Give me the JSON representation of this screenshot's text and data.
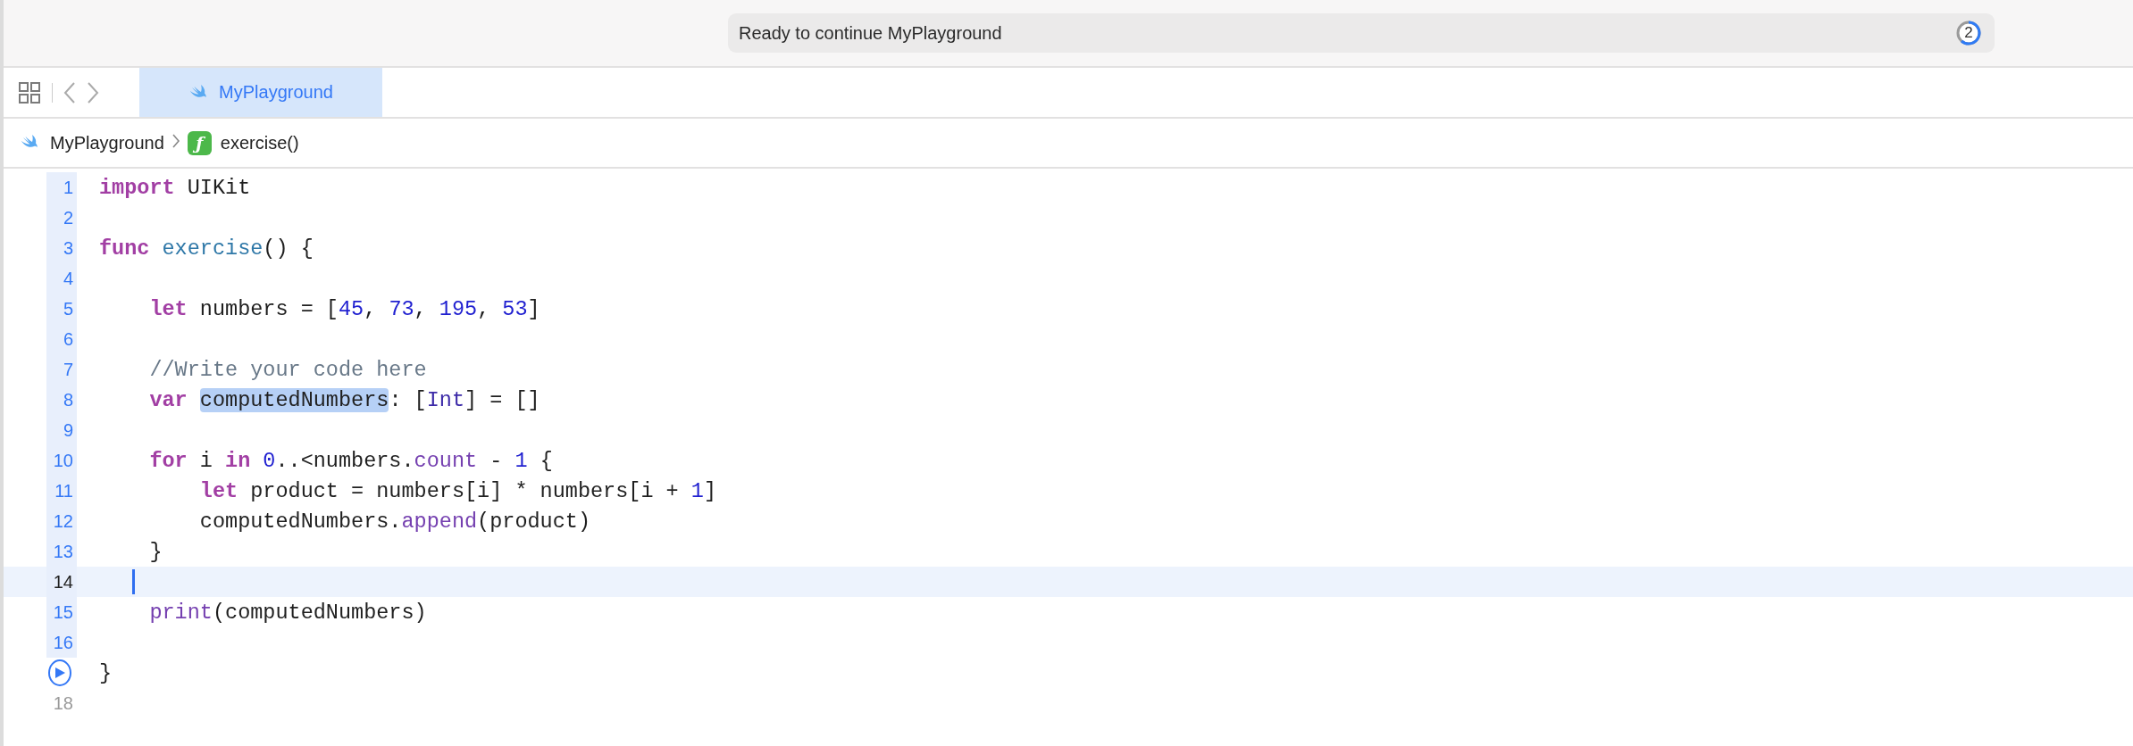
{
  "toolbar": {
    "status": "Ready to continue MyPlayground",
    "badge": "2"
  },
  "tabs": [
    {
      "label": "MyPlayground",
      "selected": true
    }
  ],
  "breadcrumb": [
    {
      "kind": "playground",
      "label": "MyPlayground"
    },
    {
      "kind": "function",
      "glyph": "ƒ",
      "label": "exercise()"
    }
  ],
  "editor": {
    "lines": [
      {
        "kind": "code",
        "number": "1",
        "ran": true,
        "current": false,
        "tokens": [
          {
            "kind": "keyword",
            "s": "import"
          },
          {
            "kind": "plain",
            "s": " UIKit"
          }
        ]
      },
      {
        "kind": "code",
        "number": "2",
        "ran": true,
        "current": false
      },
      {
        "kind": "code",
        "number": "3",
        "ran": true,
        "current": false,
        "tokens": [
          {
            "kind": "keyword",
            "s": "func "
          },
          {
            "kind": "decl",
            "s": "exercise"
          },
          {
            "kind": "plain",
            "s": "() {"
          }
        ]
      },
      {
        "kind": "code",
        "number": "4",
        "ran": true,
        "current": false
      },
      {
        "kind": "code",
        "number": "5",
        "ran": true,
        "current": false,
        "tokens": [
          {
            "kind": "keyword",
            "s": "    let"
          },
          {
            "kind": "plain",
            "s": " numbers = ["
          },
          {
            "kind": "number",
            "s": "45"
          },
          {
            "kind": "plain",
            "s": ", "
          },
          {
            "kind": "number",
            "s": "73"
          },
          {
            "kind": "plain",
            "s": ", "
          },
          {
            "kind": "number",
            "s": "195"
          },
          {
            "kind": "plain",
            "s": ", "
          },
          {
            "kind": "number",
            "s": "53"
          },
          {
            "kind": "plain",
            "s": "]"
          }
        ]
      },
      {
        "kind": "code",
        "number": "6",
        "ran": true,
        "current": false
      },
      {
        "kind": "code",
        "number": "7",
        "ran": true,
        "current": false,
        "tokens": [
          {
            "kind": "comment",
            "s": "    //Write your code here"
          }
        ]
      },
      {
        "kind": "code",
        "number": "8",
        "ran": true,
        "current": false,
        "tokens": [
          {
            "kind": "keyword",
            "s": "    var "
          },
          {
            "kind": "selected",
            "s": "computedNumbers"
          },
          {
            "kind": "plain",
            "s": ": ["
          },
          {
            "kind": "type",
            "s": "Int"
          },
          {
            "kind": "plain",
            "s": "] = []"
          }
        ]
      },
      {
        "kind": "code",
        "number": "9",
        "ran": true,
        "current": false
      },
      {
        "kind": "code",
        "number": "10",
        "ran": true,
        "current": false,
        "tokens": [
          {
            "kind": "keyword",
            "s": "    for"
          },
          {
            "kind": "plain",
            "s": " i "
          },
          {
            "kind": "keyword",
            "s": "in "
          },
          {
            "kind": "number",
            "s": "0"
          },
          {
            "kind": "plain",
            "s": "..<numbers."
          },
          {
            "kind": "member",
            "s": "count"
          },
          {
            "kind": "plain",
            "s": " - "
          },
          {
            "kind": "number",
            "s": "1"
          },
          {
            "kind": "plain",
            "s": " {"
          }
        ]
      },
      {
        "kind": "code",
        "number": "11",
        "ran": true,
        "current": false,
        "tokens": [
          {
            "kind": "keyword",
            "s": "        let"
          },
          {
            "kind": "plain",
            "s": " product = numbers[i] * numbers[i + "
          },
          {
            "kind": "number",
            "s": "1"
          },
          {
            "kind": "plain",
            "s": "]"
          }
        ]
      },
      {
        "kind": "code",
        "number": "12",
        "ran": true,
        "current": false,
        "tokens": [
          {
            "kind": "plain",
            "s": "        computedNumbers."
          },
          {
            "kind": "member",
            "s": "append"
          },
          {
            "kind": "plain",
            "s": "(product)"
          }
        ]
      },
      {
        "kind": "code",
        "number": "13",
        "ran": true,
        "current": false,
        "tokens": [
          {
            "kind": "plain",
            "s": "    }"
          }
        ]
      },
      {
        "kind": "code",
        "number": "14",
        "ran": true,
        "current": true
      },
      {
        "kind": "code",
        "number": "15",
        "ran": true,
        "current": false,
        "tokens": [
          {
            "kind": "member",
            "s": "    print"
          },
          {
            "kind": "plain",
            "s": "(computedNumbers)"
          }
        ]
      },
      {
        "kind": "code",
        "number": "16",
        "ran": true,
        "current": false
      },
      {
        "kind": "run",
        "ran": false,
        "current": false,
        "tokens": [
          {
            "kind": "plain",
            "s": "}"
          }
        ]
      },
      {
        "kind": "code",
        "number": "18",
        "ran": false,
        "current": false
      }
    ]
  }
}
